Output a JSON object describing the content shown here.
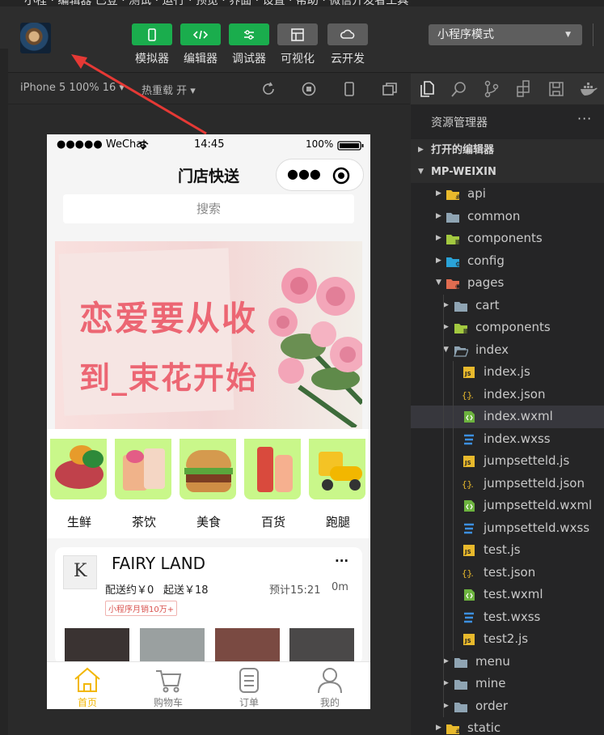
{
  "toolbar": {
    "title_fragment": "小程 · 编辑器 已登 · 测试 · 运行 · 预览 · 界面 · 设置 · 帮助 · 微信开发者工具",
    "buttons": [
      {
        "label": "模拟器",
        "icon": "simulator-icon",
        "active": true
      },
      {
        "label": "编辑器",
        "icon": "code-icon",
        "active": true
      },
      {
        "label": "调试器",
        "icon": "debugger-icon",
        "active": true
      },
      {
        "label": "可视化",
        "icon": "layout-icon",
        "active": false
      },
      {
        "label": "云开发",
        "icon": "cloud-icon",
        "active": false
      }
    ],
    "mode_select": "小程序模式",
    "colors": {
      "green": "#1aad4d",
      "gray": "#5d5d5d"
    }
  },
  "simulator": {
    "device": "iPhone 5 100% 16 ▾",
    "hot_reload": "热重载 开 ▾",
    "icons": [
      "refresh-icon",
      "stop-icon",
      "phone-icon",
      "window-icon"
    ]
  },
  "phone": {
    "status": {
      "carrier": "●●●●● WeChat",
      "time": "14:45",
      "battery": "100%"
    },
    "nav_title": "门店快送",
    "search_placeholder": "搜索",
    "banner": {
      "line1": "恋爱要从收",
      "line2": "到_束花开始"
    },
    "categories": [
      {
        "label": "生鲜",
        "color": "#c9f78a"
      },
      {
        "label": "茶饮",
        "color": "#c9f78a"
      },
      {
        "label": "美食",
        "color": "#c9f78a"
      },
      {
        "label": "百货",
        "color": "#c9f78a"
      },
      {
        "label": "跑腿",
        "color": "#c9f78a"
      }
    ],
    "shop": {
      "name": "FAIRY LAND",
      "more": "···",
      "delivery": "配送约￥0",
      "min_order": "起送￥18",
      "eta": "预计15:21",
      "distance": "0m",
      "tag": "小程序月销10万+"
    },
    "tabbar": [
      {
        "label": "首页",
        "icon": "home-icon",
        "active": true
      },
      {
        "label": "购物车",
        "icon": "cart-icon",
        "active": false
      },
      {
        "label": "订单",
        "icon": "order-icon",
        "active": false
      },
      {
        "label": "我的",
        "icon": "profile-icon",
        "active": false
      }
    ],
    "accent": "#f2b705"
  },
  "explorer": {
    "title": "资源管理器",
    "more": "···",
    "section_open": "打开的编辑器",
    "section_project": "MP-WEIXIN",
    "activity_icons": [
      "files-icon",
      "search-icon",
      "source-control-icon",
      "extensions-icon",
      "storage-icon",
      "docker-icon"
    ],
    "tree": [
      {
        "name": "api",
        "type": "folder-yellow",
        "depth": 1,
        "open": false
      },
      {
        "name": "common",
        "type": "folder",
        "depth": 1,
        "open": false
      },
      {
        "name": "components",
        "type": "folder-green",
        "depth": 1,
        "open": false
      },
      {
        "name": "config",
        "type": "folder-blue",
        "depth": 1,
        "open": false
      },
      {
        "name": "pages",
        "type": "folder-red",
        "depth": 1,
        "open": true
      },
      {
        "name": "cart",
        "type": "folder",
        "depth": 2,
        "open": false
      },
      {
        "name": "components",
        "type": "folder-green",
        "depth": 2,
        "open": false
      },
      {
        "name": "index",
        "type": "folder-open",
        "depth": 2,
        "open": true
      },
      {
        "name": "index.js",
        "type": "js",
        "depth": 3
      },
      {
        "name": "index.json",
        "type": "json",
        "depth": 3
      },
      {
        "name": "index.wxml",
        "type": "wxml",
        "depth": 3,
        "selected": true
      },
      {
        "name": "index.wxss",
        "type": "wxss",
        "depth": 3
      },
      {
        "name": "jumpsetteld.js",
        "type": "js",
        "depth": 3
      },
      {
        "name": "jumpsetteld.json",
        "type": "json",
        "depth": 3
      },
      {
        "name": "jumpsetteld.wxml",
        "type": "wxml",
        "depth": 3
      },
      {
        "name": "jumpsetteld.wxss",
        "type": "wxss",
        "depth": 3
      },
      {
        "name": "test.js",
        "type": "js",
        "depth": 3
      },
      {
        "name": "test.json",
        "type": "json",
        "depth": 3
      },
      {
        "name": "test.wxml",
        "type": "wxml",
        "depth": 3
      },
      {
        "name": "test.wxss",
        "type": "wxss",
        "depth": 3
      },
      {
        "name": "test2.js",
        "type": "js",
        "depth": 3
      },
      {
        "name": "menu",
        "type": "folder",
        "depth": 2,
        "open": false
      },
      {
        "name": "mine",
        "type": "folder",
        "depth": 2,
        "open": false
      },
      {
        "name": "order",
        "type": "folder",
        "depth": 2,
        "open": false
      },
      {
        "name": "static",
        "type": "folder-yellow",
        "depth": 1,
        "open": false
      }
    ]
  }
}
